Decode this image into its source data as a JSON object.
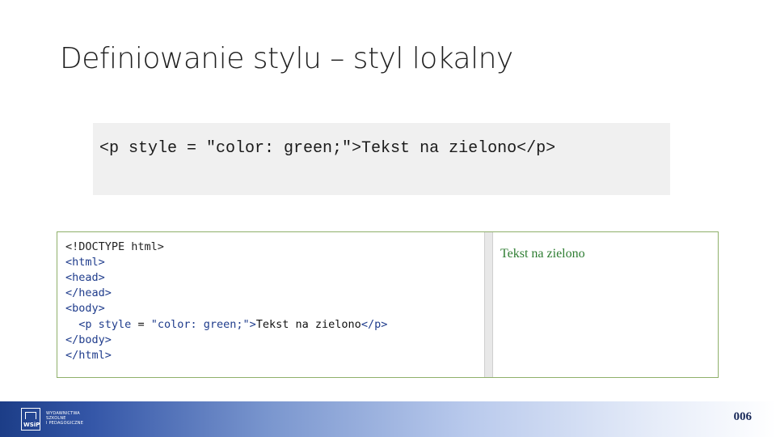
{
  "slide": {
    "title": "Definiowanie stylu – styl lokalny",
    "code_snippet": "<p style = \"color: green;\">Tekst na zielono</p>"
  },
  "editor": {
    "lines": [
      {
        "decl": "<!DOCTYPE",
        "rest": " html>"
      },
      {
        "tag": "<html>"
      },
      {
        "tag": "<head>"
      },
      {
        "tag": "</head>"
      },
      {
        "tag": "<body>"
      },
      {
        "indent": "  ",
        "open": "<p",
        "attr": " style",
        "eq": " = ",
        "val": "\"color: green;\"",
        "close": ">",
        "text": "Tekst na zielono",
        "end": "</p>"
      },
      {
        "tag": "</body>"
      },
      {
        "tag": "</html>"
      }
    ]
  },
  "preview": {
    "text": "Tekst na zielono",
    "color": "#2e7d32"
  },
  "footer": {
    "logo_text": "WSiP",
    "publisher_line1": "Wydawnictwa",
    "publisher_line2": "Szkolne",
    "publisher_line3": "i Pedagogiczne",
    "page_number": "006"
  },
  "colors": {
    "footer_start": "#1c3d87",
    "footer_end": "#ffffff",
    "panel_border": "#8fb06a",
    "code_bg": "#f0f0f0"
  }
}
